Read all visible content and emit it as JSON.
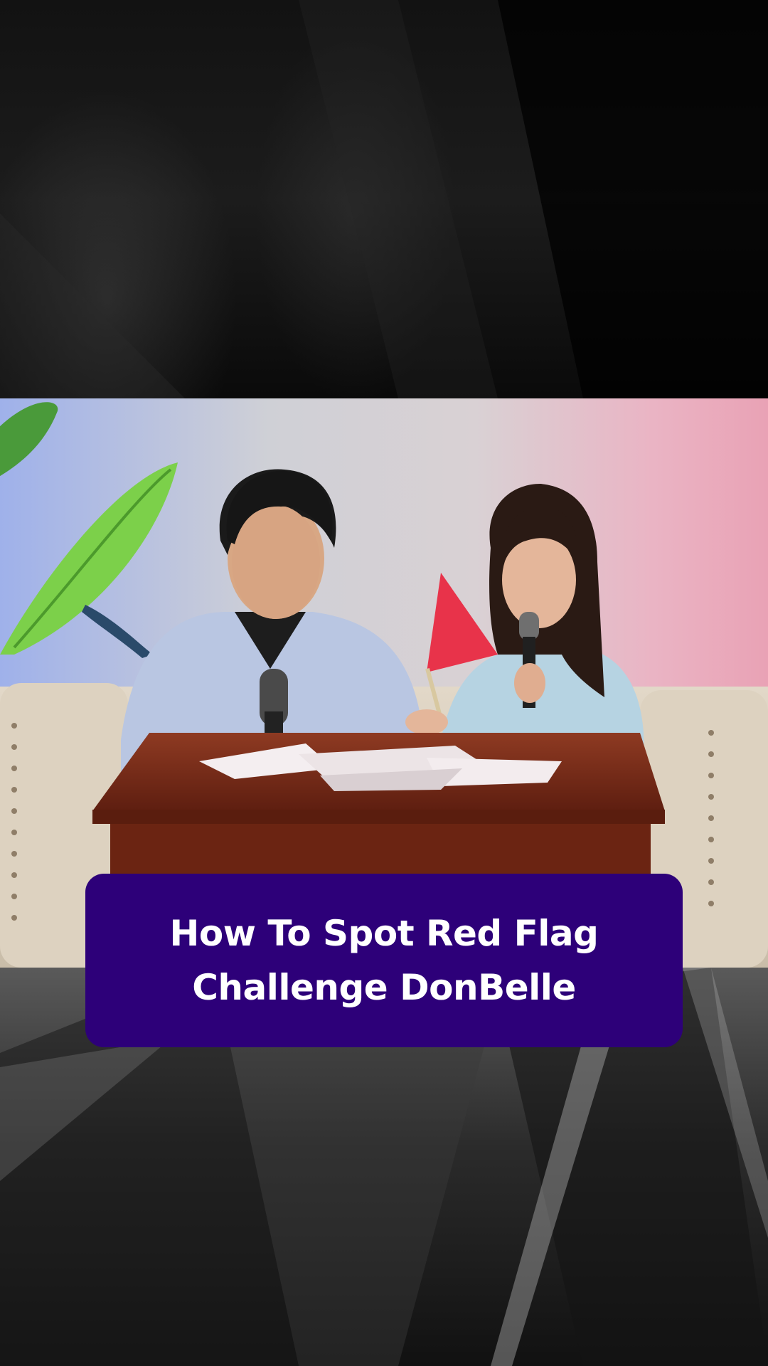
{
  "caption": {
    "line1": "How To Spot Red Flag",
    "line2": "Challenge DonBelle",
    "background_color": "#2d0079",
    "text_color": "#ffffff"
  },
  "video": {
    "description_icons": [
      "microphone-icon",
      "red-flag-icon"
    ],
    "accent_colors": {
      "wall_left": "#a9b6e6",
      "wall_right": "#e9a7b9",
      "table": "#7a2a16",
      "flag": "#e8334a"
    }
  }
}
